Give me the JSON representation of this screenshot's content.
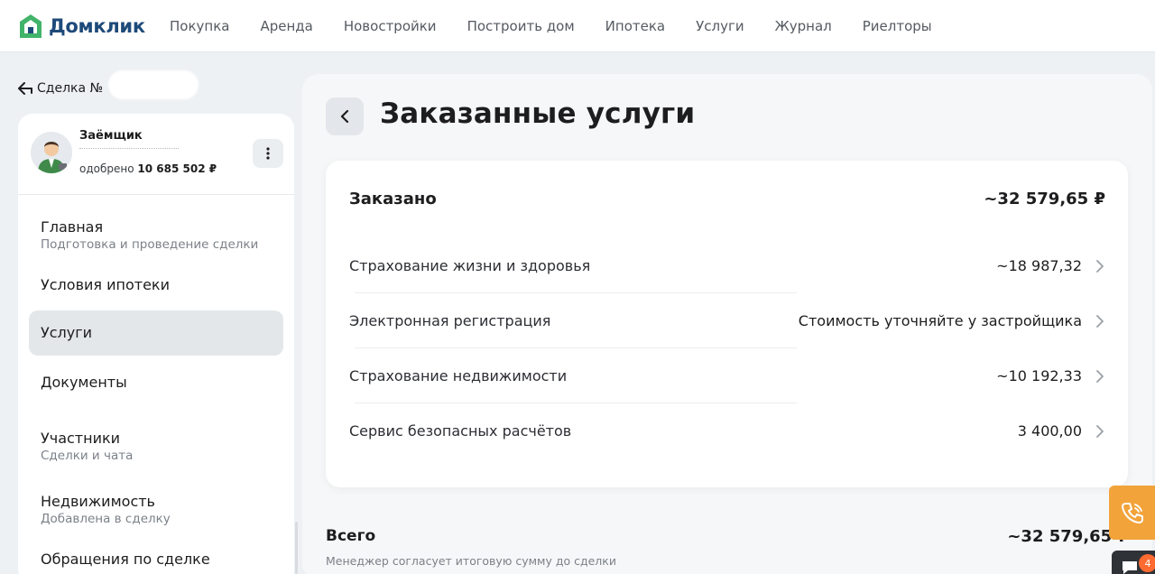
{
  "brand": {
    "name": "Домклик",
    "color": "#1e4a7a",
    "accent": "#42b36a"
  },
  "nav": [
    "Покупка",
    "Аренда",
    "Новостройки",
    "Построить дом",
    "Ипотека",
    "Услуги",
    "Журнал",
    "Риелторы"
  ],
  "deal": {
    "back_label": "Сделка №"
  },
  "profile": {
    "role": "Заёмщик",
    "approved_prefix": "одобрено",
    "approved_amount": "10 685 502 ₽"
  },
  "menu": [
    {
      "label": "Главная",
      "sub": "Подготовка и проведение сделки"
    },
    {
      "label": "Условия ипотеки",
      "sub": ""
    },
    {
      "label": "Услуги",
      "sub": "",
      "active": true
    },
    {
      "label": "Документы",
      "sub": ""
    },
    {
      "label": "Участники",
      "sub": "Сделки и чата"
    },
    {
      "label": "Недвижимость",
      "sub": "Добавлена в сделку"
    },
    {
      "label": "Обращения по сделке",
      "sub": ""
    }
  ],
  "main": {
    "title": "Заказанные услуги",
    "ordered_label": "Заказано",
    "ordered_total": "~32 579,65 ₽",
    "services": [
      {
        "name": "Страхование жизни и здоровья",
        "price": "~18 987,32"
      },
      {
        "name": "Электронная регистрация",
        "price": "Стоимость уточняйте у застройщика"
      },
      {
        "name": "Страхование недвижимости",
        "price": "~10 192,33"
      },
      {
        "name": "Сервис безопасных расчётов",
        "price": "3 400,00"
      }
    ],
    "total_label": "Всего",
    "total_value": "~32 579,65 ₽",
    "note": "Менеджер согласует итоговую сумму до сделки"
  },
  "widgets": {
    "chat_badge": "4",
    "call_color": "#f2a33a"
  }
}
